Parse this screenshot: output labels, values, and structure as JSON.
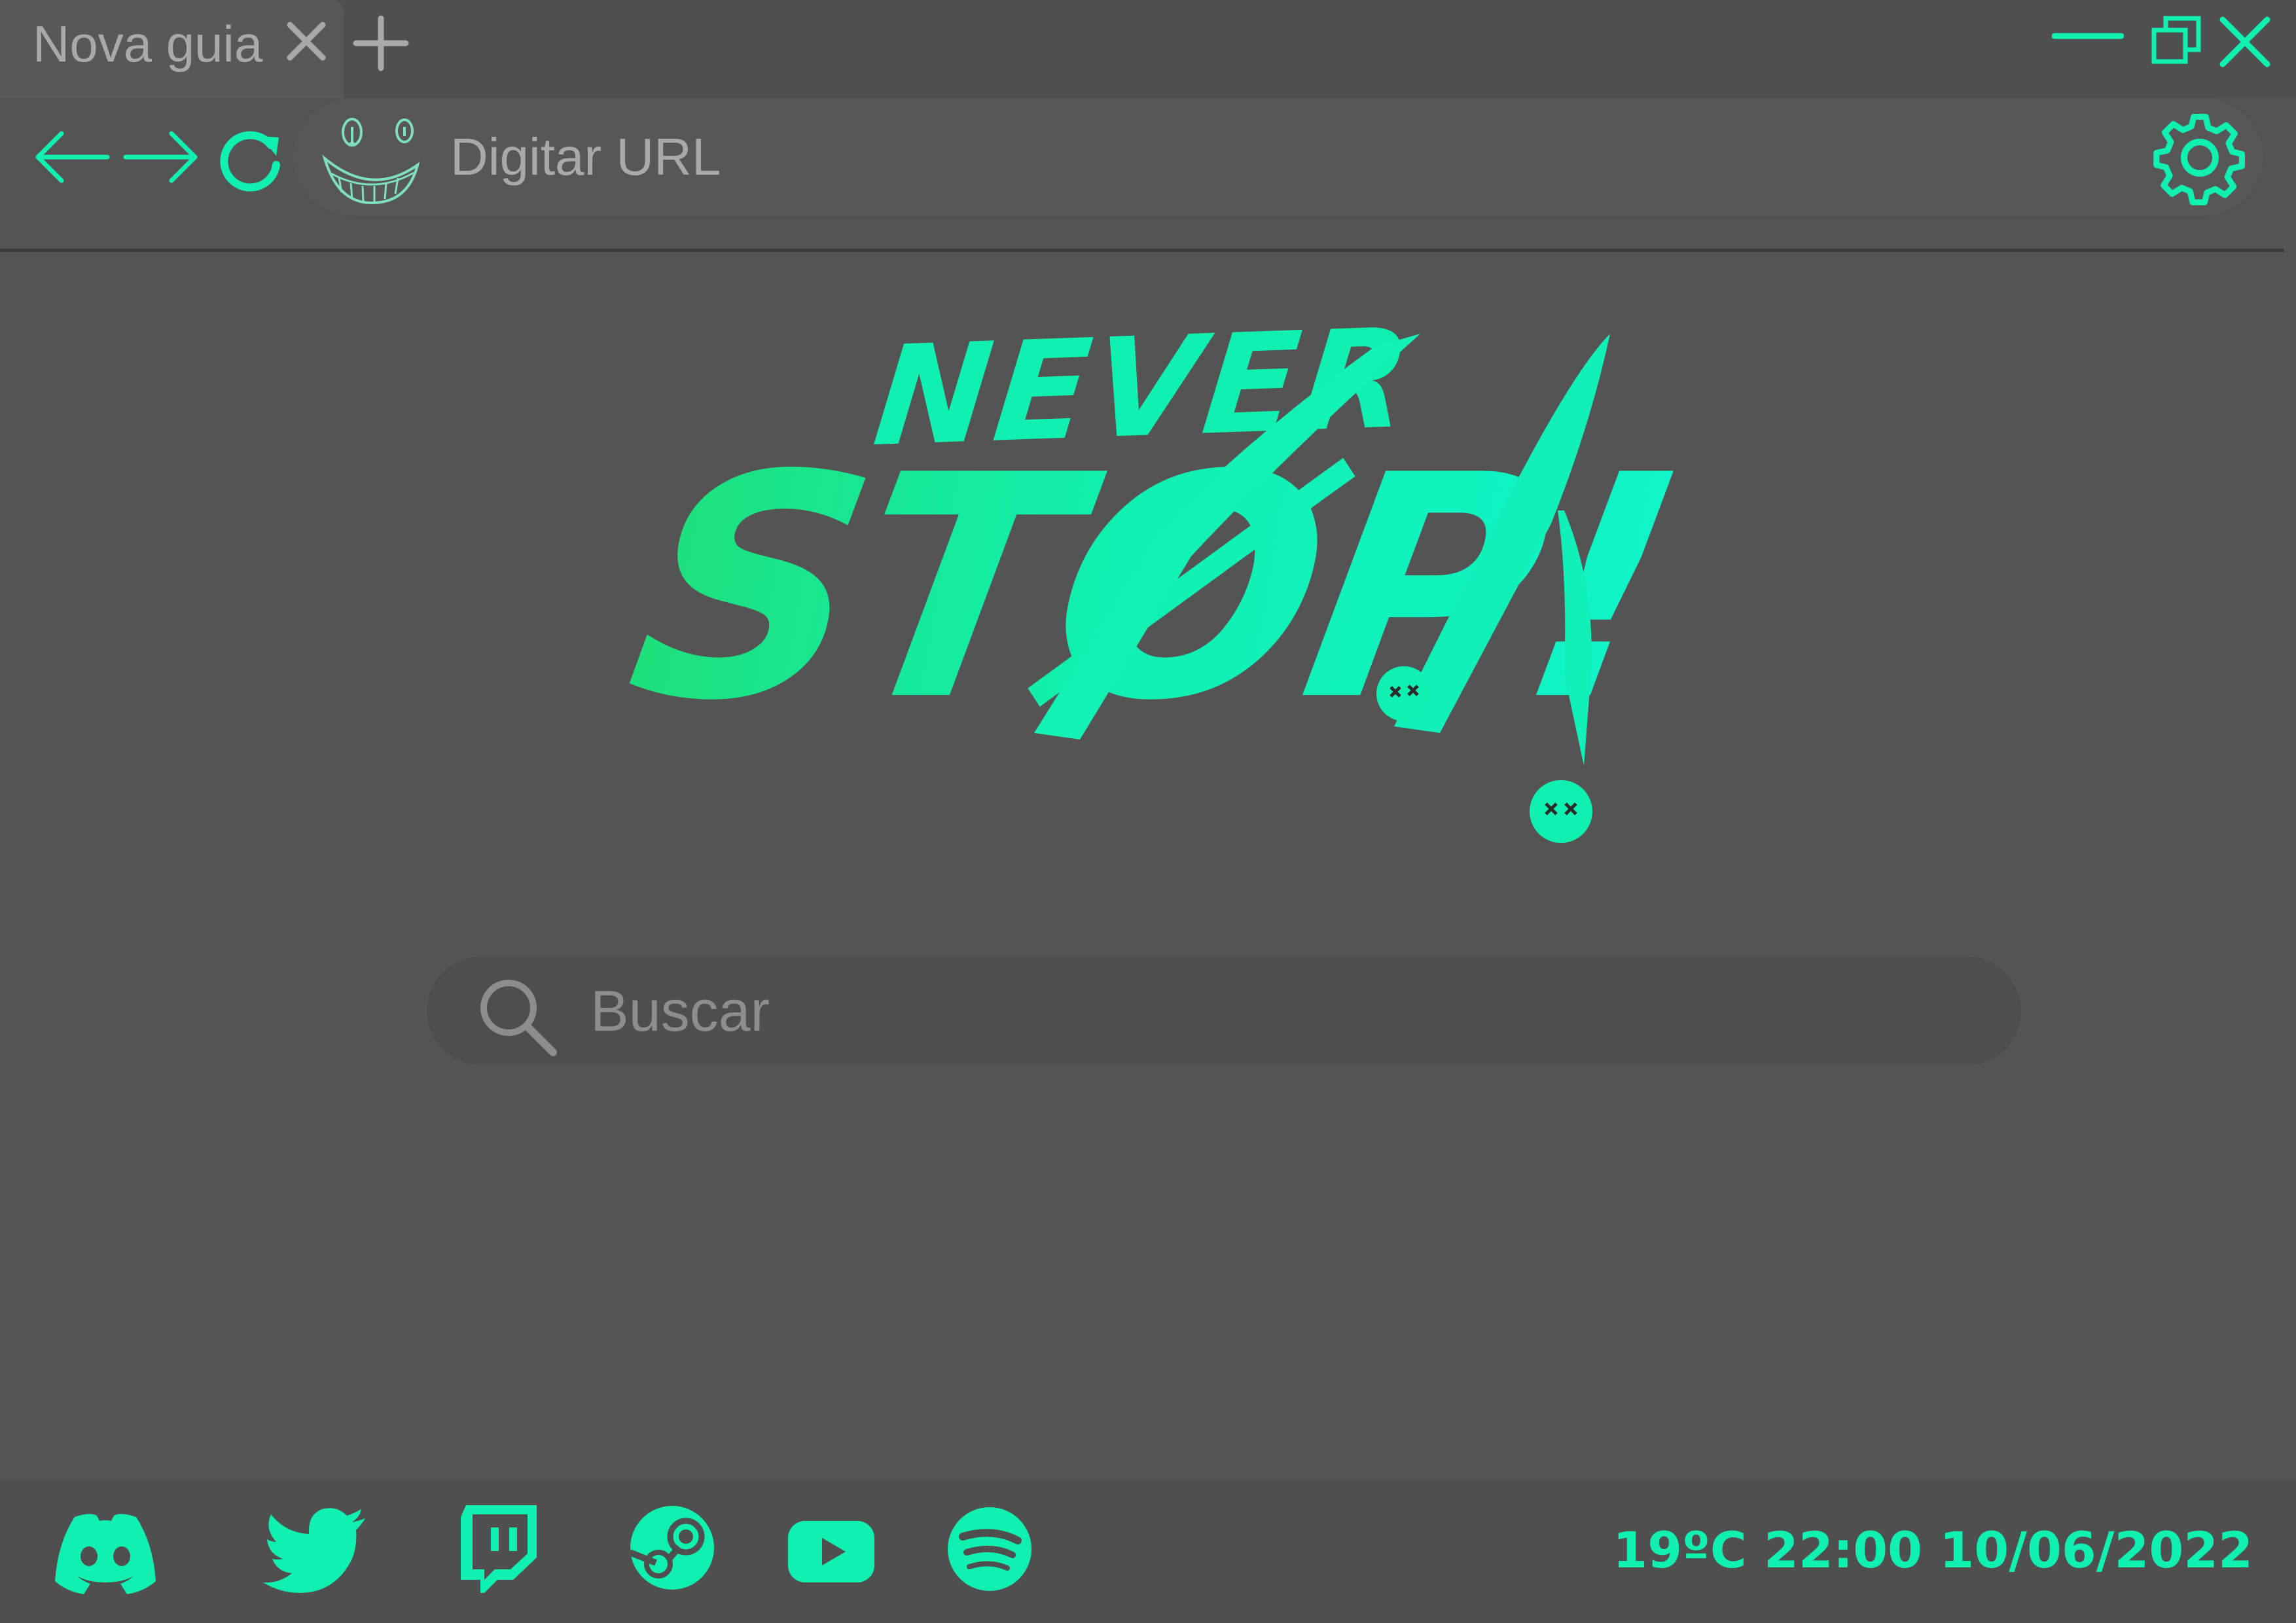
{
  "theme": {
    "accent": "#10f0b0",
    "background": "#545454",
    "tabstrip_background": "#4f4f4f",
    "muted_text": "#a9a9a9"
  },
  "tab": {
    "title": "Nova guia",
    "close_icon": "close-icon",
    "new_tab_icon": "plus-icon"
  },
  "window_controls": {
    "minimize_icon": "minimize-icon",
    "restore_icon": "restore-icon",
    "close_icon": "close-icon"
  },
  "toolbar": {
    "back_icon": "arrow-left-icon",
    "forward_icon": "arrow-right-icon",
    "reload_icon": "reload-icon",
    "site_icon": "grinning-face-icon",
    "url_placeholder": "Digitar URL",
    "settings_icon": "gear-icon"
  },
  "logo": {
    "line1": "NEVER",
    "line2": "STØP!"
  },
  "search": {
    "icon": "search-icon",
    "placeholder": "Buscar"
  },
  "footer": {
    "shortcuts": [
      {
        "name": "Discord",
        "icon": "discord-icon"
      },
      {
        "name": "Twitter",
        "icon": "twitter-icon"
      },
      {
        "name": "Twitch",
        "icon": "twitch-icon"
      },
      {
        "name": "Steam",
        "icon": "steam-icon"
      },
      {
        "name": "YouTube",
        "icon": "youtube-icon"
      },
      {
        "name": "Spotify",
        "icon": "spotify-icon"
      }
    ],
    "status": "19ºC 22:00 10/06/2022"
  }
}
